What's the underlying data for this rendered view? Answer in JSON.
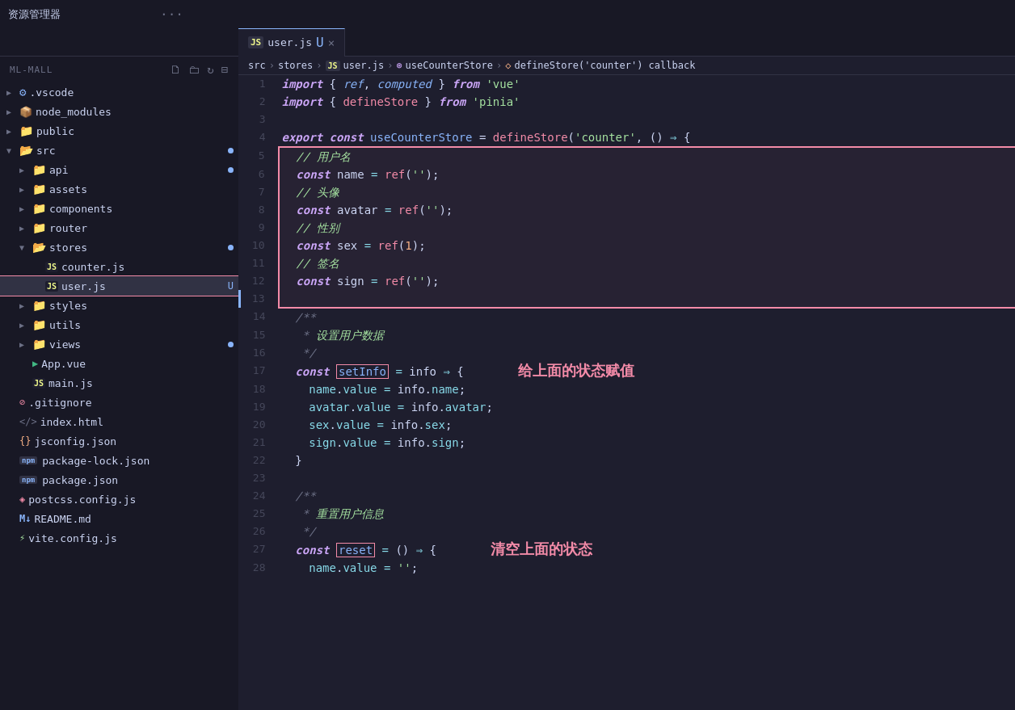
{
  "titlebar": {
    "explorer_label": "资源管理器",
    "dots": "···"
  },
  "tabs": [
    {
      "id": "user-js",
      "icon": "JS",
      "label": "user.js",
      "modified": "U",
      "close": "×",
      "active": true
    },
    {
      "id": "placeholder",
      "icon": "",
      "label": "",
      "close": "×",
      "active": false
    }
  ],
  "breadcrumb": {
    "items": [
      "src",
      "stores",
      "JS user.js",
      "useCounterStore",
      "defineStore('counter') callback"
    ]
  },
  "sidebar": {
    "title": "ML-MALL",
    "items": [
      {
        "name": ".vscode",
        "type": "folder",
        "indent": 1,
        "collapsed": true
      },
      {
        "name": "node_modules",
        "type": "folder-node",
        "indent": 1,
        "collapsed": true
      },
      {
        "name": "public",
        "type": "folder",
        "indent": 1,
        "collapsed": true
      },
      {
        "name": "src",
        "type": "folder",
        "indent": 1,
        "collapsed": false,
        "badge": true
      },
      {
        "name": "api",
        "type": "folder",
        "indent": 2,
        "collapsed": true,
        "badge": true
      },
      {
        "name": "assets",
        "type": "folder",
        "indent": 2,
        "collapsed": true
      },
      {
        "name": "components",
        "type": "folder",
        "indent": 2,
        "collapsed": true
      },
      {
        "name": "router",
        "type": "folder",
        "indent": 2,
        "collapsed": true
      },
      {
        "name": "stores",
        "type": "folder",
        "indent": 2,
        "collapsed": false,
        "badge": true
      },
      {
        "name": "counter.js",
        "type": "js",
        "indent": 3
      },
      {
        "name": "user.js",
        "type": "js",
        "indent": 3,
        "modified": "U",
        "active": true
      },
      {
        "name": "styles",
        "type": "folder",
        "indent": 2,
        "collapsed": true
      },
      {
        "name": "utils",
        "type": "folder",
        "indent": 2,
        "collapsed": true
      },
      {
        "name": "views",
        "type": "folder",
        "indent": 2,
        "collapsed": true,
        "badge": true
      },
      {
        "name": "App.vue",
        "type": "vue",
        "indent": 2
      },
      {
        "name": "main.js",
        "type": "js",
        "indent": 2
      },
      {
        "name": ".gitignore",
        "type": "git",
        "indent": 1
      },
      {
        "name": "index.html",
        "type": "html",
        "indent": 1
      },
      {
        "name": "jsconfig.json",
        "type": "json",
        "indent": 1
      },
      {
        "name": "package-lock.json",
        "type": "npm-json",
        "indent": 1
      },
      {
        "name": "package.json",
        "type": "npm-json2",
        "indent": 1
      },
      {
        "name": "postcss.config.js",
        "type": "css-js",
        "indent": 1
      },
      {
        "name": "README.md",
        "type": "md",
        "indent": 1
      },
      {
        "name": "vite.config.js",
        "type": "vite",
        "indent": 1
      }
    ]
  },
  "annotations": {
    "give_values": "给上面的状态赋值",
    "clear_state": "清空上面的状态"
  }
}
